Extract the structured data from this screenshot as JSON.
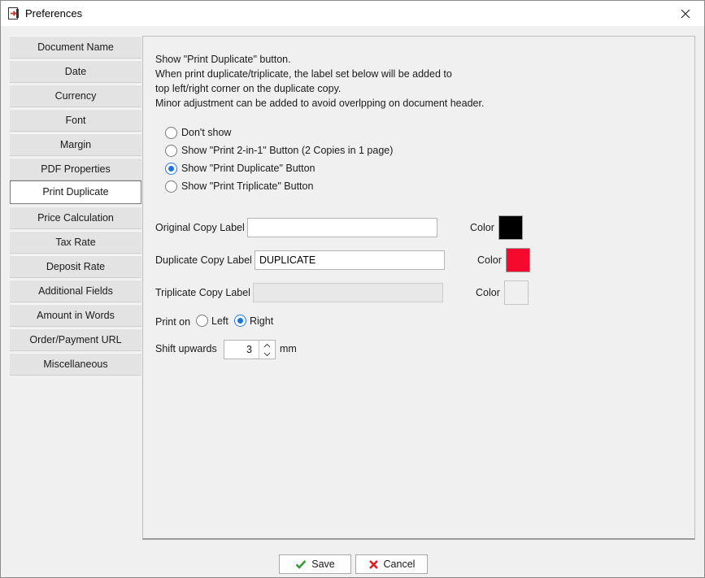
{
  "window": {
    "title": "Preferences"
  },
  "sidebar": {
    "active_index": 6,
    "items": [
      {
        "label": "Document Name"
      },
      {
        "label": "Date"
      },
      {
        "label": "Currency"
      },
      {
        "label": "Font"
      },
      {
        "label": "Margin"
      },
      {
        "label": "PDF Properties"
      },
      {
        "label": "Print Duplicate"
      },
      {
        "label": "Price Calculation"
      },
      {
        "label": "Tax Rate"
      },
      {
        "label": "Deposit Rate"
      },
      {
        "label": "Additional Fields"
      },
      {
        "label": "Amount in Words"
      },
      {
        "label": "Order/Payment URL"
      },
      {
        "label": "Miscellaneous"
      }
    ]
  },
  "panel": {
    "description": [
      "Show \"Print Duplicate\" button.",
      "When print duplicate/triplicate, the label set below will be added to",
      "top left/right corner on the duplicate copy.",
      "Minor adjustment can be added to avoid overlpping on document header."
    ],
    "options": [
      {
        "label": "Don't show",
        "checked": false
      },
      {
        "label": "Show \"Print 2-in-1\" Button (2 Copies in 1 page)",
        "checked": false
      },
      {
        "label": "Show \"Print Duplicate\" Button",
        "checked": true
      },
      {
        "label": "Show \"Print Triplicate\" Button",
        "checked": false
      }
    ],
    "original": {
      "label": "Original Copy Label",
      "value": "",
      "color_label": "Color",
      "color": "#000000"
    },
    "duplicate": {
      "label": "Duplicate Copy Label",
      "value": "DUPLICATE",
      "color_label": "Color",
      "color": "#f50a2e"
    },
    "triplicate": {
      "label": "Triplicate Copy Label",
      "value": "",
      "color_label": "Color",
      "color": "#f0f0f0",
      "disabled": true
    },
    "print_on": {
      "label": "Print on",
      "left_label": "Left",
      "right_label": "Right",
      "selected": "Right"
    },
    "shift": {
      "label": "Shift upwards",
      "value": "3",
      "unit": "mm"
    }
  },
  "footer": {
    "save_label": "Save",
    "cancel_label": "Cancel",
    "save_icon_color": "#3a9a3a",
    "cancel_icon_color": "#e02020"
  }
}
